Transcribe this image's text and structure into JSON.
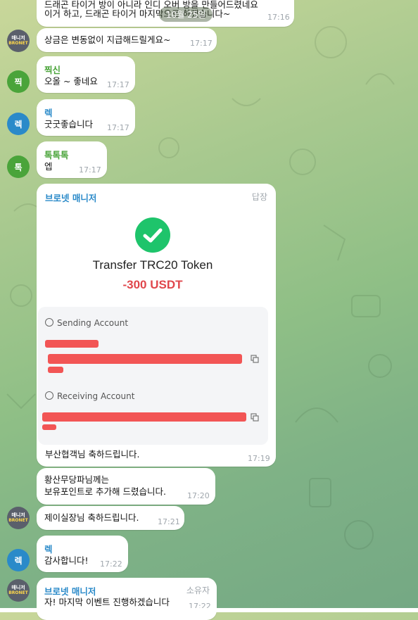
{
  "date_pill": "10월 25일",
  "messages": {
    "m0": {
      "line1": "드래곤 타이거 방이 아니라 인디 오버 방을 만들어드렸네요",
      "line2": "이거 하고, 드래곤 타이거 마지막으로 하겠습니다~",
      "time": "17:16"
    },
    "m1": {
      "text": "상금은 변동없이 지급해드릴게요~",
      "time": "17:17"
    },
    "m2": {
      "sender": "찍신",
      "text": "오올 ~ 좋네요",
      "time": "17:17",
      "avatar": "찍"
    },
    "m3": {
      "sender": "렉",
      "text": "굿굿좋습니다",
      "time": "17:17",
      "avatar": "렉"
    },
    "m4": {
      "sender": "톡톡톡",
      "text": "엡",
      "time": "17:17",
      "avatar": "톡"
    },
    "m5": {
      "sender": "브로넷 매니저",
      "tag": "답장",
      "title": "Transfer TRC20 Token",
      "amount": "-300 USDT",
      "sending_label": "Sending Account",
      "receiving_label": "Receiving Account",
      "text": "부산협객님 축하드립니다.",
      "time": "17:19"
    },
    "m6": {
      "line1": "황산무당파님께는",
      "line2": "보유포인트로 추가해 드렸습니다.",
      "time": "17:20"
    },
    "m7": {
      "text": "제이실장님 축하드립니다.",
      "time": "17:21"
    },
    "m8": {
      "sender": "렉",
      "text": "감사합니다!",
      "time": "17:22",
      "avatar": "렉"
    },
    "m9": {
      "sender": "브로넷 매니저",
      "tag": "소유자",
      "text": "자! 마지막 이벤트 진행하겠습니다",
      "time": "17:22"
    }
  },
  "manager_avatar": {
    "line1": "매니저",
    "line2": "BRONET"
  },
  "colors": {
    "green": "#4aa43a",
    "blue": "#2a8ac9",
    "red": "#e0474c",
    "check": "#1ec46b"
  }
}
